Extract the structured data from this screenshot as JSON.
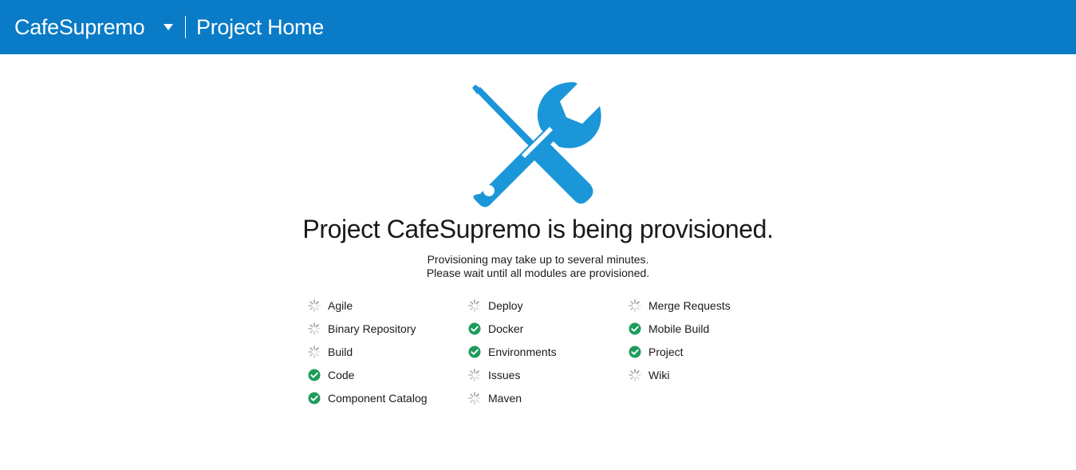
{
  "header": {
    "project_name": "CafeSupremo",
    "page_title": "Project Home",
    "background_color": "#0a7bc7"
  },
  "hero": {
    "icon": "wrench-screwdriver-icon",
    "icon_color": "#1b96d8",
    "headline": "Project CafeSupremo is being provisioned.",
    "subtext_line1": "Provisioning may take up to several minutes.",
    "subtext_line2": "Please wait until all modules are provisioned."
  },
  "modules": {
    "columns": [
      [
        {
          "label": "Agile",
          "status": "pending"
        },
        {
          "label": "Binary Repository",
          "status": "pending"
        },
        {
          "label": "Build",
          "status": "pending"
        },
        {
          "label": "Code",
          "status": "done"
        },
        {
          "label": "Component Catalog",
          "status": "done"
        }
      ],
      [
        {
          "label": "Deploy",
          "status": "pending"
        },
        {
          "label": "Docker",
          "status": "done"
        },
        {
          "label": "Environments",
          "status": "done"
        },
        {
          "label": "Issues",
          "status": "pending"
        },
        {
          "label": "Maven",
          "status": "pending"
        }
      ],
      [
        {
          "label": "Merge Requests",
          "status": "pending"
        },
        {
          "label": "Mobile Build",
          "status": "done"
        },
        {
          "label": "Project",
          "status": "done"
        },
        {
          "label": "Wiki",
          "status": "pending"
        }
      ]
    ],
    "done_color": "#1e9c5b",
    "pending_color": "#8a8a8a"
  }
}
